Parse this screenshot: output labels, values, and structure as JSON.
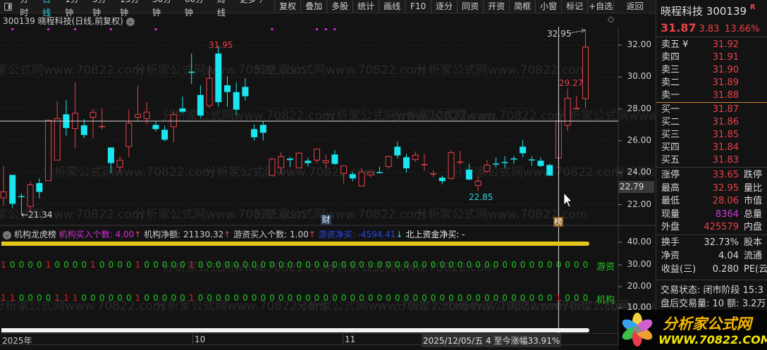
{
  "toolbar": {
    "tabs": [
      "分时",
      "日线",
      "1分钟",
      "5分钟",
      "15分钟",
      "30分钟",
      "60分钟",
      "周线",
      "更多 〉"
    ],
    "active_tab": 1,
    "buttons": [
      "复权",
      "叠加",
      "多股",
      "统计",
      "画线",
      "F10",
      "逐分",
      "同资",
      "开资",
      "简框",
      "小窗",
      "标记",
      "+自选"
    ],
    "back": "返回"
  },
  "chart_header": {
    "title": "300139 晓程科技(日线,前复权)"
  },
  "watermark": "分析家公式网www.70822.com",
  "colors": {
    "up": "#e8424a",
    "down": "#19e6f0",
    "bg": "#131313",
    "accent": "#2fd3e0",
    "yellow": "#e6c619"
  },
  "chart": {
    "type": "candlestick",
    "ylim": [
      21,
      33
    ],
    "yticks": [
      "32.00",
      "30.00",
      "28.00",
      "26.00",
      "24.00",
      "22.00"
    ],
    "ytick_values": [
      32,
      30,
      28,
      26,
      24,
      22
    ],
    "cursor_price": "22.79",
    "crosshair_price": 27.23,
    "crosshair_index": 62,
    "annotations": {
      "high_label": "31.95",
      "top_label": "32.95",
      "mid_label": "29.27",
      "low_label": "22.85",
      "min_label": "←21.34"
    },
    "markers": {
      "cai": "财",
      "bang": "榜"
    },
    "magenta_marks": [
      1,
      5,
      8,
      12,
      17,
      30,
      35,
      36,
      37
    ],
    "ohlc": [
      [
        22.42,
        22.8,
        24.41,
        21.92
      ],
      [
        23.86,
        22.05,
        23.86,
        21.8
      ],
      [
        22.5,
        22.48,
        22.7,
        21.34
      ],
      [
        21.88,
        23.24,
        23.42,
        21.58
      ],
      [
        23.35,
        22.79,
        23.64,
        22.39
      ],
      [
        23.49,
        27.29,
        27.29,
        23.49
      ],
      [
        24.79,
        27.39,
        28.5,
        24.79
      ],
      [
        27.66,
        26.8,
        28.54,
        26.32
      ],
      [
        26.77,
        27.73,
        29.67,
        25.52
      ],
      [
        26.97,
        26.36,
        27.35,
        26.17
      ],
      [
        27.47,
        27.79,
        27.98,
        26.14
      ],
      [
        26.87,
        26.89,
        28.03,
        26.7
      ],
      [
        25.58,
        24.6,
        25.58,
        23.98
      ],
      [
        24.35,
        24.79,
        25.04,
        24.05
      ],
      [
        25.63,
        27.1,
        27.94,
        24.97
      ],
      [
        27.47,
        27.66,
        29.45,
        27.17
      ],
      [
        27.39,
        27.8,
        28.42,
        27.02
      ],
      [
        27.0,
        26.73,
        27.25,
        26.58
      ],
      [
        26.69,
        26.07,
        26.94,
        25.97
      ],
      [
        26.88,
        27.64,
        27.88,
        25.92
      ],
      [
        28.03,
        27.82,
        28.76,
        27.73
      ],
      [
        30.3,
        30.28,
        31.47,
        29.56
      ],
      [
        28.87,
        27.58,
        29.48,
        27.44
      ],
      [
        28.2,
        29.92,
        30.71,
        28.06
      ],
      [
        31.47,
        28.42,
        31.95,
        28.13
      ],
      [
        29.48,
        29.06,
        30.04,
        28.13
      ],
      [
        29.05,
        27.95,
        29.65,
        27.61
      ],
      [
        29.38,
        28.79,
        29.92,
        28.53
      ],
      [
        26.73,
        26.22,
        27.02,
        26.03
      ],
      [
        27.0,
        26.5,
        27.22,
        26.03
      ],
      [
        23.82,
        24.85,
        24.92,
        23.82
      ],
      [
        24.3,
        25.01,
        25.29,
        23.91
      ],
      [
        24.88,
        24.79,
        25.0,
        24.35
      ],
      [
        24.3,
        25.23,
        25.29,
        24.3
      ],
      [
        24.75,
        24.6,
        24.94,
        24.38
      ],
      [
        24.79,
        25.48,
        25.48,
        24.6
      ],
      [
        24.63,
        24.75,
        25.14,
        24.3
      ],
      [
        25.14,
        24.55,
        25.43,
        24.49
      ],
      [
        23.96,
        24.42,
        24.42,
        23.32
      ],
      [
        23.91,
        23.64,
        24.05,
        23.47
      ],
      [
        23.16,
        24.04,
        24.3,
        23.16
      ],
      [
        23.86,
        24.04,
        24.04,
        23.71
      ],
      [
        24.0,
        23.99,
        24.38,
        23.95
      ],
      [
        24.38,
        25.01,
        25.07,
        24.25
      ],
      [
        25.63,
        25.08,
        25.95,
        24.9
      ],
      [
        24.97,
        24.27,
        25.18,
        24.01
      ],
      [
        24.82,
        25.1,
        25.33,
        24.67
      ],
      [
        24.48,
        24.5,
        25.18,
        24.11
      ],
      [
        23.9,
        23.92,
        24.14,
        23.71
      ],
      [
        23.69,
        23.47,
        23.82,
        23.27
      ],
      [
        23.64,
        25.26,
        25.4,
        23.57
      ],
      [
        24.64,
        24.66,
        25.37,
        24.49
      ],
      [
        24.19,
        23.57,
        24.56,
        23.53
      ],
      [
        23.2,
        23.47,
        23.77,
        22.85
      ],
      [
        24.08,
        24.48,
        24.79,
        23.98
      ],
      [
        24.54,
        24.5,
        24.94,
        24.35
      ],
      [
        24.64,
        24.6,
        25.04,
        24.27
      ],
      [
        24.86,
        24.83,
        25.04,
        24.56
      ],
      [
        25.63,
        25.22,
        26.03,
        24.97
      ],
      [
        24.8,
        24.78,
        25.04,
        24.42
      ],
      [
        24.75,
        24.42,
        24.94,
        24.35
      ],
      [
        24.48,
        23.82,
        24.56,
        23.79
      ],
      [
        24.92,
        27.25,
        28.31,
        24.33
      ],
      [
        26.97,
        28.67,
        29.27,
        26.61
      ],
      [
        28.0,
        28.02,
        28.82,
        28.0
      ],
      [
        28.64,
        31.87,
        32.95,
        28.06
      ]
    ]
  },
  "indicator": {
    "name": "机构龙虎榜",
    "inst_buy_count": "机构买入个数: 4.00",
    "inst_net": "机构净额: 21130.32",
    "hot_buy_count": "游资买入个数: 1.00",
    "hot_net": "游资净买: -4594.41",
    "north_net": "北上资金净买: -",
    "arrow_up": "↑",
    "arrow_down": "↓",
    "yticks": [
      "40.00",
      "30.00",
      "20.00",
      "10.00"
    ],
    "row_hot_label": "游资",
    "row_inst_label": "机构",
    "row_hot": [
      1,
      0,
      0,
      0,
      0,
      1,
      0,
      0,
      0,
      0,
      1,
      0,
      0,
      0,
      0,
      1,
      0,
      0,
      0,
      0,
      0,
      1,
      0,
      0,
      0,
      0,
      0,
      0,
      0,
      0,
      0,
      0,
      0,
      0,
      0,
      0,
      0,
      0,
      0,
      0,
      0,
      0,
      0,
      0,
      0,
      0,
      0,
      0,
      0,
      0,
      0,
      0,
      0,
      0,
      0,
      0,
      0,
      0,
      0,
      0,
      0,
      0,
      0,
      0,
      0,
      0
    ],
    "row_inst": [
      1,
      1,
      0,
      0,
      0,
      0,
      1,
      1,
      1,
      0,
      0,
      0,
      0,
      0,
      0,
      1,
      0,
      0,
      0,
      0,
      0,
      1,
      0,
      0,
      0,
      0,
      0,
      0,
      0,
      0,
      0,
      0,
      0,
      0,
      0,
      0,
      0,
      0,
      0,
      0,
      0,
      0,
      0,
      0,
      0,
      0,
      0,
      0,
      0,
      0,
      0,
      0,
      0,
      0,
      0,
      0,
      0,
      0,
      0,
      0,
      0,
      0,
      1,
      0,
      0,
      0
    ]
  },
  "time_axis": {
    "labels": [
      "2025年",
      "10",
      "11"
    ],
    "cursor_date": "2025/12/05/五 4 至今涨幅33.91%"
  },
  "quote": {
    "name": "晓程科技",
    "code": "300139",
    "flag": "R",
    "price": "31.87",
    "change": "3.83",
    "pct": "13.66%",
    "sell": [
      {
        "l": "卖五 ¥",
        "v": "31.92"
      },
      {
        "l": "卖四",
        "v": "31.91"
      },
      {
        "l": "卖三",
        "v": "31.90"
      },
      {
        "l": "卖二",
        "v": "31.89"
      },
      {
        "l": "卖一",
        "v": "31.88"
      }
    ],
    "buy": [
      {
        "l": "买一",
        "v": "31.87"
      },
      {
        "l": "买二",
        "v": "31.86"
      },
      {
        "l": "买三",
        "v": "31.85"
      },
      {
        "l": "买四",
        "v": "31.84"
      },
      {
        "l": "买五",
        "v": "31.83"
      }
    ],
    "stats": [
      {
        "l": "涨停",
        "v": "33.65",
        "l2": "跌停"
      },
      {
        "l": "最高",
        "v": "32.95",
        "l2": "量比"
      },
      {
        "l": "最低",
        "v": "28.06",
        "l2": "市值"
      },
      {
        "l": "现量",
        "v": "8364",
        "l2": "总量"
      },
      {
        "l": "外盘",
        "v": "425579",
        "l2": "内盘"
      }
    ],
    "fund": [
      {
        "l": "换手",
        "v": "32.73%",
        "l2": "股本"
      },
      {
        "l": "净资",
        "v": "4.04",
        "l2": "流通"
      },
      {
        "l": "收益(三)",
        "v": "0.280",
        "l2": "PE(云"
      }
    ],
    "status": "交易状态: 闭市阶段 15:3",
    "after": "盘后交易量: 10  额: 3.2万"
  },
  "logo": {
    "title": "分析家公式网",
    "url": "WWW.70822.COM"
  }
}
